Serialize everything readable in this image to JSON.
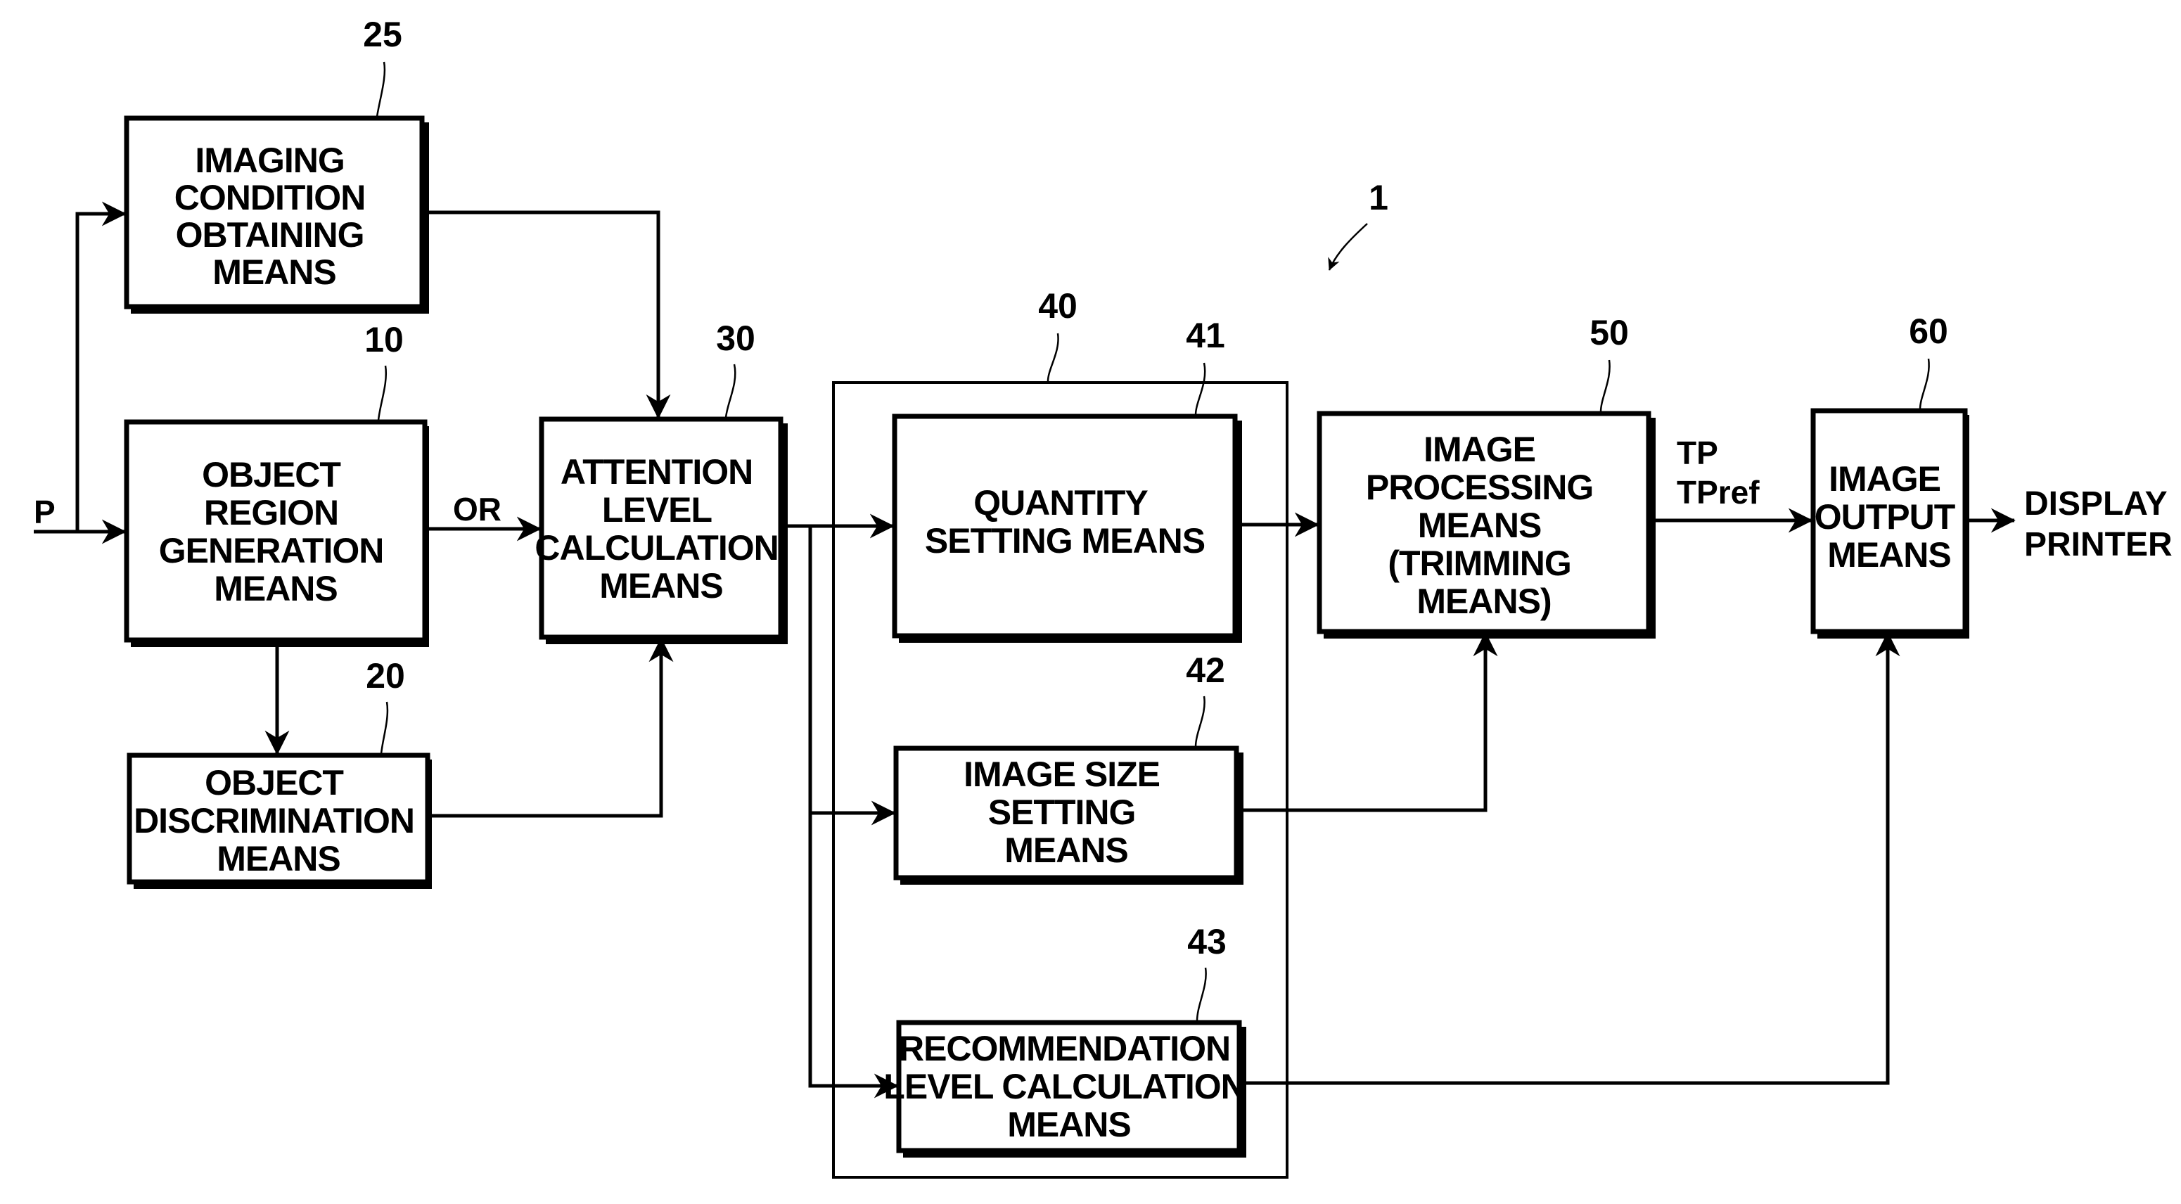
{
  "figure": {
    "system_ref": "1",
    "blocks": [
      {
        "id": "imaging-condition",
        "ref": "25",
        "lines": [
          "IMAGING",
          "CONDITION",
          "OBTAINING",
          "MEANS"
        ]
      },
      {
        "id": "object-region",
        "ref": "10",
        "lines": [
          "OBJECT",
          "REGION",
          "GENERATION",
          "MEANS"
        ]
      },
      {
        "id": "object-discrimination",
        "ref": "20",
        "lines": [
          "OBJECT",
          "DISCRIMINATION",
          "MEANS"
        ]
      },
      {
        "id": "attention-level",
        "ref": "30",
        "lines": [
          "ATTENTION",
          "LEVEL",
          "CALCULATION",
          "MEANS"
        ]
      },
      {
        "id": "quantity-setting",
        "ref": "41",
        "lines": [
          "QUANTITY",
          "SETTING MEANS"
        ]
      },
      {
        "id": "image-size-setting",
        "ref": "42",
        "lines": [
          "IMAGE SIZE",
          "SETTING",
          "MEANS"
        ]
      },
      {
        "id": "recommendation-level",
        "ref": "43",
        "lines": [
          "RECOMMENDATION",
          "LEVEL CALCULATION",
          "MEANS"
        ]
      },
      {
        "id": "image-processing",
        "ref": "50",
        "lines": [
          "IMAGE",
          "PROCESSING",
          "MEANS",
          "(TRIMMING",
          "MEANS)"
        ]
      },
      {
        "id": "image-output",
        "ref": "60",
        "lines": [
          "IMAGE",
          "OUTPUT",
          "MEANS"
        ]
      }
    ],
    "group": {
      "id": "setting-group",
      "ref": "40"
    },
    "signals": {
      "input": "P",
      "object_region": "OR",
      "trimmed_1": "TP",
      "trimmed_2": "TPref"
    },
    "outputs": [
      "DISPLAY",
      "PRINTER"
    ]
  }
}
